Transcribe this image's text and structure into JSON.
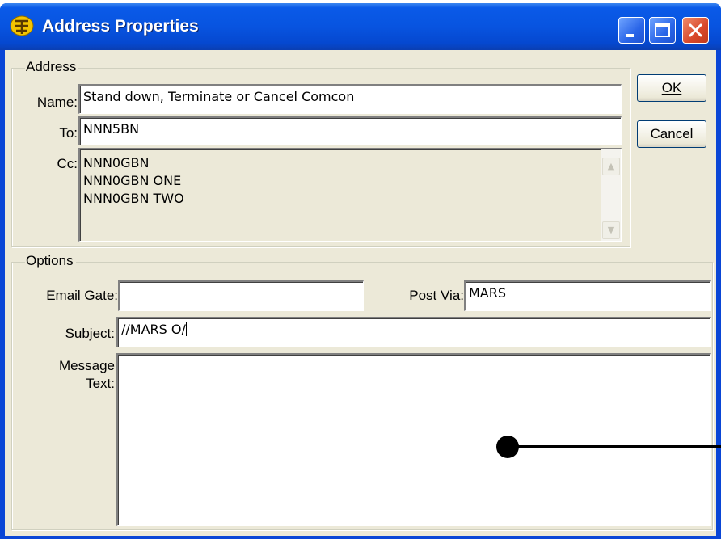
{
  "window": {
    "title": "Address Properties",
    "icons": {
      "app": "app-icon",
      "minimize": "minimize-icon",
      "maximize": "maximize-icon",
      "close": "close-icon"
    }
  },
  "address": {
    "legend": "Address",
    "name_label": "Name:",
    "name_value": "Stand down, Terminate or Cancel Comcon",
    "to_label": "To:",
    "to_value": "NNN5BN",
    "cc_label": "Cc:",
    "cc_values": [
      "NNN0GBN",
      "NNN0GBN ONE",
      "NNN0GBN TWO"
    ]
  },
  "buttons": {
    "ok_label": "OK",
    "cancel_label": "Cancel"
  },
  "options": {
    "legend": "Options",
    "email_gate_label": "Email Gate:",
    "email_gate_value": "",
    "post_via_label": "Post Via:",
    "post_via_value": "MARS",
    "subject_label": "Subject:",
    "subject_value": "//MARS O/",
    "message_label_line1": "Message",
    "message_label_line2": "Text:",
    "message_value": ""
  },
  "colors": {
    "titlebar": "#0a5ae8",
    "client_bg": "#ece9d8",
    "close_button": "#d8482a"
  }
}
